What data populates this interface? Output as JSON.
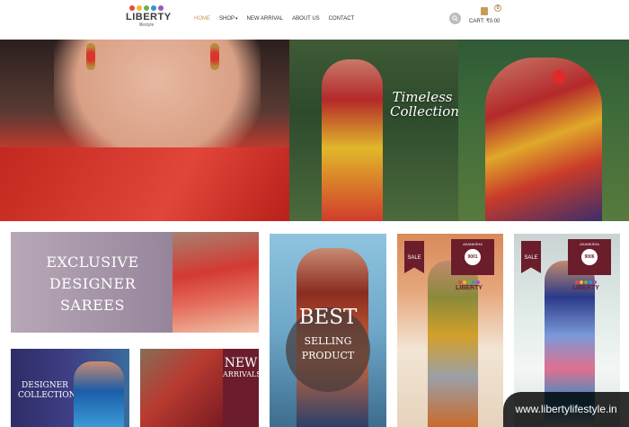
{
  "brand": {
    "name": "LIBERTY",
    "tagline": "lifestyle",
    "dot_colors": [
      "#e84b3a",
      "#f5b53a",
      "#6bb44a",
      "#3a8fd8",
      "#9b59b6"
    ]
  },
  "nav": {
    "items": [
      {
        "label": "HOME",
        "active": true
      },
      {
        "label": "SHOP",
        "has_dropdown": true
      },
      {
        "label": "NEW ARRIVAL"
      },
      {
        "label": "ABOUT US"
      },
      {
        "label": "CONTACT"
      }
    ]
  },
  "header": {
    "search_icon": "search-icon",
    "cart_label": "CART: ₹0.00",
    "cart_count": "0",
    "cart_icon": "shopping-bag-icon"
  },
  "hero": {
    "tagline_line1": "Timeless",
    "tagline_line2": "Collection"
  },
  "promos": {
    "exclusive": {
      "line1": "EXCLUSIVE",
      "line2": "DESIGNER",
      "line3": "SAREES"
    },
    "designer": {
      "line1": "DESIGNER",
      "line2": "COLLECTION"
    },
    "new_arrivals": {
      "line1": "NEW",
      "line2": "ARRIVALS"
    },
    "best": {
      "line1": "BEST",
      "line2": "SELLING",
      "line3": "PRODUCT"
    },
    "sale1": {
      "badge": "SALE",
      "brand": "AKANKSHA",
      "code": "9001"
    },
    "sale2": {
      "badge": "SALE",
      "brand": "AKANKSHA",
      "code": "9006"
    }
  },
  "watermark": "www.libertylifestyle.in",
  "colors": {
    "accent": "#c89a58",
    "maroon": "#6b1d2c"
  }
}
